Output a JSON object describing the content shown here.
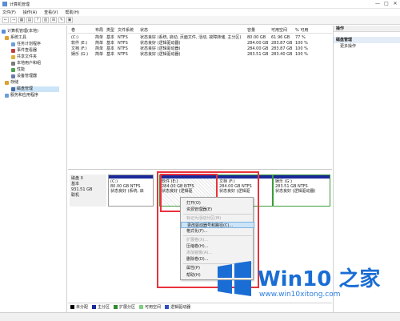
{
  "window": {
    "title": "计算机管理",
    "min": "—",
    "max": "□",
    "close": "✕"
  },
  "menu": [
    "文件(F)",
    "操作(A)",
    "查看(V)",
    "帮助(H)"
  ],
  "toolbar": [
    "←",
    "→",
    "▦",
    "▤",
    "?",
    "▥",
    "⊞",
    "✎",
    "▣"
  ],
  "tree": [
    {
      "label": "计算机管理(本地)",
      "color": "#5a8dd6"
    },
    {
      "label": "系统工具",
      "color": "#e0a030"
    },
    {
      "label": "任务计划程序",
      "color": "#6a9fd8"
    },
    {
      "label": "事件查看器",
      "color": "#c04040"
    },
    {
      "label": "共享文件夹",
      "color": "#e0b040"
    },
    {
      "label": "本地用户和组",
      "color": "#7a7a7a"
    },
    {
      "label": "性能",
      "color": "#50a050"
    },
    {
      "label": "设备管理器",
      "color": "#6a7ab0"
    },
    {
      "label": "存储",
      "color": "#e0a030"
    },
    {
      "label": "磁盘管理",
      "color": "#4a6aa0"
    },
    {
      "label": "服务和应用程序",
      "color": "#6a9fd8"
    }
  ],
  "volume_columns": [
    "卷",
    "布局",
    "类型",
    "文件系统",
    "状态",
    "容量",
    "可用空间",
    "% 可用"
  ],
  "volumes": [
    {
      "name": "(C:)",
      "layout": "简单",
      "type": "基本",
      "fs": "NTFS",
      "status": "状态良好 (系统, 启动, 页面文件, 活动, 故障转储, 主分区)",
      "capacity": "80.00 GB",
      "free": "61.96 GB",
      "pct": "77 %"
    },
    {
      "name": "软件 (E:)",
      "layout": "简单",
      "type": "基本",
      "fs": "NTFS",
      "status": "状态良好 (逻辑驱动器)",
      "capacity": "284.00 GB",
      "free": "283.87 GB",
      "pct": "100 %"
    },
    {
      "name": "文档 (F:)",
      "layout": "简单",
      "type": "基本",
      "fs": "NTFS",
      "status": "状态良好 (逻辑驱动器)",
      "capacity": "284.00 GB",
      "free": "283.87 GB",
      "pct": "100 %"
    },
    {
      "name": "娱乐 (G:)",
      "layout": "简单",
      "type": "基本",
      "fs": "NTFS",
      "status": "状态良好 (逻辑驱动器)",
      "capacity": "283.51 GB",
      "free": "283.40 GB",
      "pct": "100 %"
    }
  ],
  "disk": {
    "name": "磁盘 0",
    "type": "基本",
    "size": "931.51 GB",
    "state": "联机"
  },
  "partitions": [
    {
      "name": "(C:)",
      "size": "80.00 GB NTFS",
      "status": "状态良好 (系统, 启",
      "bar": "#1a2a9a"
    },
    {
      "name": "软件 (E:)",
      "size": "284.00 GB NTFS",
      "status": "状态良好 (逻辑驱",
      "bar": "#1a2a9a"
    },
    {
      "name": "文档 (F:)",
      "size": "284.00 GB NTFS",
      "status": "状态良好 (逻辑驱",
      "bar": "#1a2a9a"
    },
    {
      "name": "娱乐 (G:)",
      "size": "283.51 GB NTFS",
      "status": "状态良好 (逻辑驱动器)",
      "bar": "#1a2a9a"
    }
  ],
  "context_menu": [
    {
      "label": "打开(O)",
      "enabled": true
    },
    {
      "label": "资源管理器(E)",
      "enabled": true
    },
    {
      "label": "标记为活动分区(M)",
      "enabled": false
    },
    {
      "label": "更改驱动器号和路径(C)...",
      "enabled": true,
      "highlight": true
    },
    {
      "label": "格式化(F)...",
      "enabled": true
    },
    {
      "label": "扩展卷(X)...",
      "enabled": false
    },
    {
      "label": "压缩卷(H)...",
      "enabled": true
    },
    {
      "label": "添加镜像(A)...",
      "enabled": false
    },
    {
      "label": "删除卷(D)...",
      "enabled": true
    },
    {
      "label": "属性(P)",
      "enabled": true
    },
    {
      "label": "帮助(H)",
      "enabled": true
    }
  ],
  "actions": {
    "header": "操作",
    "section": "磁盘管理",
    "more": "更多操作"
  },
  "legend": [
    {
      "label": "未分配",
      "color": "#000000"
    },
    {
      "label": "主分区",
      "color": "#1a2a9a"
    },
    {
      "label": "扩展分区",
      "color": "#2e8b2e"
    },
    {
      "label": "可用空间",
      "color": "#7ed07e"
    },
    {
      "label": "逻辑驱动器",
      "color": "#3050c0"
    }
  ],
  "watermark": {
    "title": "Win10 之家",
    "url": "www.win10xitong.com"
  },
  "colors": {
    "highlight_box": "#e8323c",
    "brand_blue": "#1a6dd4"
  }
}
